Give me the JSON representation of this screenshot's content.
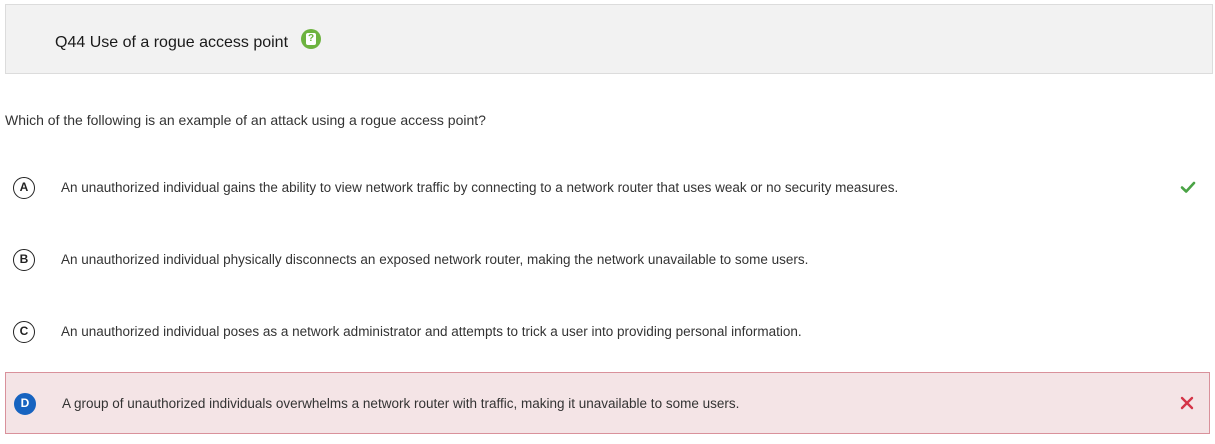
{
  "header": {
    "title": "Q44 Use of a rogue access point",
    "help_icon_color": "#6db33f",
    "help_icon_glyph": "?"
  },
  "question": {
    "text": "Which of the following is an example of an attack using a rogue access point?"
  },
  "options": [
    {
      "letter": "A",
      "text": "An unauthorized individual gains the ability to view network traffic by connecting to a network router that uses weak or no security measures.",
      "status": "correct",
      "status_icon": "check-icon"
    },
    {
      "letter": "B",
      "text": "An unauthorized individual physically disconnects an exposed network router, making the network unavailable to some users.",
      "status": "none"
    },
    {
      "letter": "C",
      "text": "An unauthorized individual poses as a network administrator and attempts to trick a user into providing personal information.",
      "status": "none"
    },
    {
      "letter": "D",
      "text": "A group of unauthorized individuals overwhelms a network router with traffic, making it unavailable to some users.",
      "status": "selected-incorrect",
      "status_icon": "x-icon"
    }
  ],
  "colors": {
    "correct": "#4aa345",
    "incorrect": "#d43447",
    "selected_badge": "#1763c0",
    "wrong_bg": "#f4e4e6",
    "wrong_border": "#d9919b"
  }
}
